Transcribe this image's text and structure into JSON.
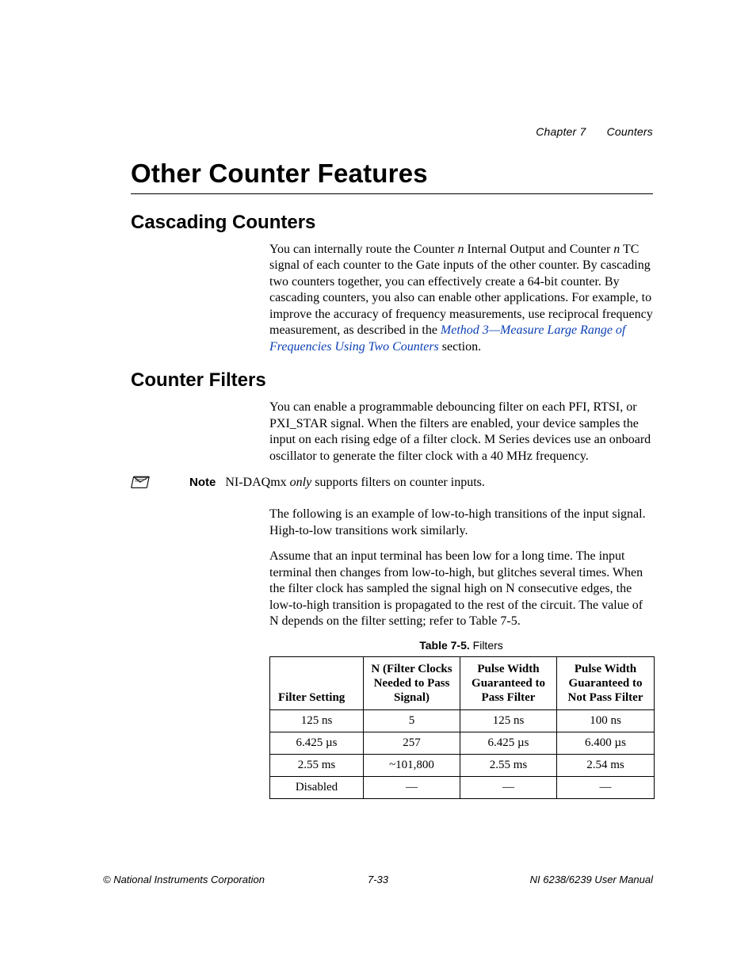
{
  "header": {
    "chapter": "Chapter 7",
    "title": "Counters"
  },
  "h1": "Other Counter Features",
  "cascading": {
    "heading": "Cascading Counters",
    "p_part1": "You can internally route the Counter ",
    "p_n1": "n",
    "p_part2": " Internal Output and Counter ",
    "p_n2": "n",
    "p_part3": " TC signal of each counter to the Gate inputs of the other counter. By cascading two counters together, you can effectively create a 64-bit counter. By cascading counters, you also can enable other applications. For example, to improve the accuracy of frequency measurements, use reciprocal frequency measurement, as described in the ",
    "link": "Method 3—Measure Large Range of Frequencies Using Two Counters",
    "p_part4": " section."
  },
  "filters": {
    "heading": "Counter Filters",
    "p1": "You can enable a programmable debouncing filter on each PFI, RTSI, or PXI_STAR signal. When the filters are enabled, your device samples the input on each rising edge of a filter clock. M Series devices use an onboard oscillator to generate the filter clock with a 40 MHz frequency.",
    "note_label": "Note",
    "note_pre": "NI-DAQmx ",
    "note_only": "only",
    "note_post": " supports filters on counter inputs.",
    "p2": "The following is an example of low-to-high transitions of the input signal. High-to-low transitions work similarly.",
    "p3": "Assume that an input terminal has been low for a long time. The input terminal then changes from low-to-high, but glitches several times. When the filter clock has sampled the signal high on N consecutive edges, the low-to-high transition is propagated to the rest of the circuit. The value of N depends on the filter setting; refer to Table 7-5."
  },
  "table": {
    "caption_bold": "Table 7-5.",
    "caption_rest": "  Filters",
    "headers": {
      "c1": "Filter Setting",
      "c2": "N (Filter Clocks Needed to Pass Signal)",
      "c3": "Pulse Width Guaranteed to Pass Filter",
      "c4": "Pulse Width Guaranteed to Not Pass Filter"
    },
    "rows": [
      {
        "c1": "125 ns",
        "c2": "5",
        "c3": "125 ns",
        "c4": "100 ns"
      },
      {
        "c1": "6.425 µs",
        "c2": "257",
        "c3": "6.425 µs",
        "c4": "6.400 µs"
      },
      {
        "c1": "2.55 ms",
        "c2": "~101,800",
        "c3": "2.55 ms",
        "c4": "2.54 ms"
      },
      {
        "c1": "Disabled",
        "c2": "—",
        "c3": "—",
        "c4": "—"
      }
    ]
  },
  "footer": {
    "left": "© National Instruments Corporation",
    "center": "7-33",
    "right": "NI 6238/6239 User Manual"
  }
}
